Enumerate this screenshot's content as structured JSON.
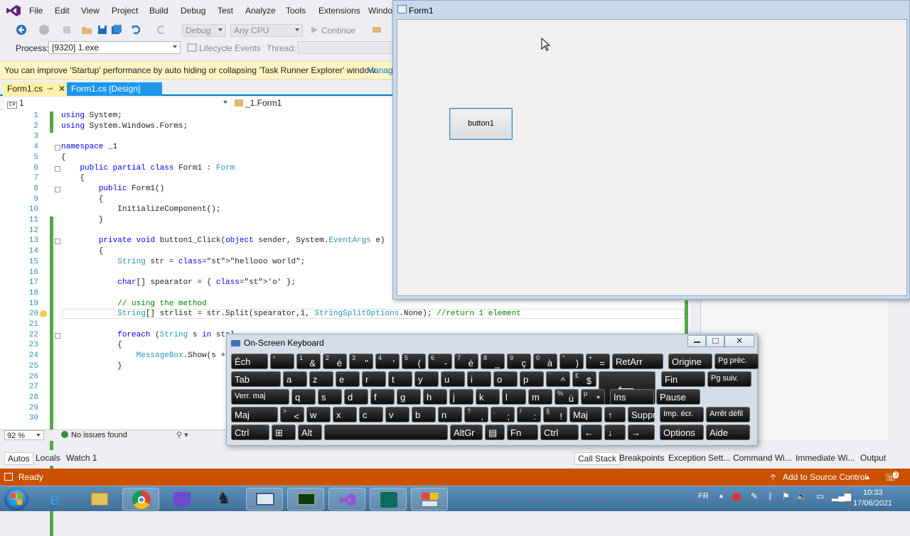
{
  "menu": [
    "File",
    "Edit",
    "View",
    "Project",
    "Build",
    "Debug",
    "Test",
    "Analyze",
    "Tools",
    "Extensions",
    "Windo"
  ],
  "toolbar": {
    "config": "Debug",
    "platform": "Any CPU",
    "continue": "Continue"
  },
  "toolbar2": {
    "process_label": "Process:",
    "process_value": "[9320] 1.exe",
    "lifecycle": "Lifecycle Events",
    "thread_label": "Thread:"
  },
  "infobar": {
    "message": "You can improve 'Startup' performance by auto hiding or collapsing 'Task Runner Explorer' window.",
    "link": "Manag"
  },
  "tabs": [
    {
      "label": "Form1.cs"
    },
    {
      "label": "Form1.cs [Design]"
    }
  ],
  "navbar": {
    "left": "1",
    "right": "_1.Form1"
  },
  "code": [
    {
      "n": "1",
      "t": "using System;"
    },
    {
      "n": "2",
      "t": "using System.Windows.Forms;"
    },
    {
      "n": "3",
      "t": ""
    },
    {
      "n": "4",
      "t": "namespace _1"
    },
    {
      "n": "5",
      "t": "{"
    },
    {
      "n": "6",
      "t": "    public partial class Form1 : Form"
    },
    {
      "n": "7",
      "t": "    {"
    },
    {
      "n": "8",
      "t": "        public Form1()"
    },
    {
      "n": "9",
      "t": "        {"
    },
    {
      "n": "10",
      "t": "            InitializeComponent();"
    },
    {
      "n": "11",
      "t": "        }"
    },
    {
      "n": "12",
      "t": ""
    },
    {
      "n": "13",
      "t": "        private void button1_Click(object sender, System.EventArgs e)"
    },
    {
      "n": "14",
      "t": "        {"
    },
    {
      "n": "15",
      "t": "            String str = \"hellooo world\";"
    },
    {
      "n": "16",
      "t": ""
    },
    {
      "n": "17",
      "t": "            char[] spearator = { 'o' };"
    },
    {
      "n": "18",
      "t": ""
    },
    {
      "n": "19",
      "t": "            // using the method"
    },
    {
      "n": "20",
      "t": "            String[] strlist = str.Split(spearator,1, StringSplitOptions.None); //return 1 element"
    },
    {
      "n": "21",
      "t": ""
    },
    {
      "n": "22",
      "t": "            foreach (String s in strl"
    },
    {
      "n": "23",
      "t": "            {"
    },
    {
      "n": "24",
      "t": "                MessageBox.Show(s + \""
    },
    {
      "n": "25",
      "t": "            }"
    },
    {
      "n": "26",
      "t": ""
    },
    {
      "n": "27",
      "t": ""
    },
    {
      "n": "28",
      "t": ""
    },
    {
      "n": "29",
      "t": ""
    },
    {
      "n": "30",
      "t": ""
    }
  ],
  "editor_status": {
    "zoom": "92 %",
    "issues": "No issues found"
  },
  "bottom_tabs_left": [
    "Autos",
    "Locals",
    "Watch 1"
  ],
  "bottom_tabs_right": [
    "Call Stack",
    "Breakpoints",
    "Exception Sett...",
    "Command Wi...",
    "Immediate Wi...",
    "Output"
  ],
  "status": {
    "ready": "Ready",
    "source_control": "Add to Source Control",
    "notif": "3"
  },
  "form1": {
    "title": "Form1",
    "button": "button1"
  },
  "osk": {
    "title": "On-Screen Keyboard",
    "rows": [
      [
        {
          "m": "Éch",
          "w": 52
        },
        {
          "s": "²",
          "w": 34
        },
        {
          "s": "1",
          "b": "&",
          "w": 34
        },
        {
          "s": "2",
          "b": "é",
          "w": 34
        },
        {
          "s": "3",
          "b": "\"",
          "w": 34
        },
        {
          "s": "4",
          "b": "'",
          "w": 34
        },
        {
          "s": "5",
          "b": "(",
          "w": 34
        },
        {
          "s": "6",
          "b": "-",
          "w": 34
        },
        {
          "s": "7",
          "b": "è",
          "w": 34
        },
        {
          "s": "8",
          "b": "_",
          "w": 34
        },
        {
          "s": "9",
          "b": "ç",
          "w": 34
        },
        {
          "s": "0",
          "b": "à",
          "w": 34
        },
        {
          "s": "°",
          "b": ")",
          "w": 34
        },
        {
          "s": "+",
          "b": "=",
          "w": 34
        },
        {
          "m": "RetArr",
          "w": 72
        },
        {
          "m": "Origine",
          "w": 62,
          "gap": 4
        },
        {
          "m": "Pg préc.",
          "w": 62
        }
      ],
      [
        {
          "m": "Tab",
          "w": 70
        },
        {
          "m": "a",
          "w": 34
        },
        {
          "m": "z",
          "w": 34
        },
        {
          "m": "e",
          "w": 34
        },
        {
          "m": "r",
          "w": 34
        },
        {
          "m": "t",
          "w": 34
        },
        {
          "m": "y",
          "w": 34
        },
        {
          "m": "u",
          "w": 34
        },
        {
          "m": "i",
          "w": 34
        },
        {
          "m": "o",
          "w": 34
        },
        {
          "m": "p",
          "w": 34
        },
        {
          "s": "¨",
          "b": "^",
          "w": 34
        },
        {
          "s": "£",
          "b": "$",
          "w": 34
        },
        {
          "m": "",
          "w": 0,
          "enter": true
        },
        {
          "m": "Fin",
          "w": 62,
          "gap": 4
        },
        {
          "m": "Pg suiv.",
          "w": 62
        }
      ],
      [
        {
          "m": "Verr. maj",
          "w": 82
        },
        {
          "m": "q",
          "w": 34
        },
        {
          "m": "s",
          "w": 34
        },
        {
          "m": "d",
          "w": 34
        },
        {
          "m": "f",
          "w": 34
        },
        {
          "m": "g",
          "w": 34
        },
        {
          "m": "h",
          "w": 34
        },
        {
          "m": "j",
          "w": 34
        },
        {
          "m": "k",
          "w": 34
        },
        {
          "m": "l",
          "w": 34
        },
        {
          "m": "m",
          "w": 34
        },
        {
          "s": "%",
          "b": "ù",
          "w": 34
        },
        {
          "s": "µ",
          "b": "*",
          "w": 34
        },
        {
          "m": "Ins",
          "w": 62,
          "gap": 4
        },
        {
          "m": "Pause",
          "w": 62
        }
      ],
      [
        {
          "m": "Maj",
          "w": 66
        },
        {
          "s": ">",
          "b": "<",
          "w": 34
        },
        {
          "m": "w",
          "w": 34
        },
        {
          "m": "x",
          "w": 34
        },
        {
          "m": "c",
          "w": 34
        },
        {
          "m": "v",
          "w": 34
        },
        {
          "m": "b",
          "w": 34
        },
        {
          "m": "n",
          "w": 34
        },
        {
          "s": "?",
          "b": ",",
          "w": 34
        },
        {
          "s": ".",
          "b": ";",
          "w": 34
        },
        {
          "s": "/",
          "b": ":",
          "w": 34
        },
        {
          "s": "§",
          "b": "!",
          "w": 34
        },
        {
          "m": "Maj",
          "w": 46
        },
        {
          "m": "↑",
          "w": 30
        },
        {
          "m": "Suppr",
          "w": 38
        },
        {
          "m": "Imp. écr.",
          "w": 62,
          "gap": 4
        },
        {
          "m": "Arrêt défil",
          "w": 62
        }
      ],
      [
        {
          "m": "Ctrl",
          "w": 54
        },
        {
          "m": "⊞",
          "w": 34
        },
        {
          "m": "Alt",
          "w": 34
        },
        {
          "m": "",
          "w": 174
        },
        {
          "m": "AltGr",
          "w": 46
        },
        {
          "m": "▤",
          "w": 28
        },
        {
          "m": "Fn",
          "w": 44
        },
        {
          "m": "Ctrl",
          "w": 54
        },
        {
          "m": "←",
          "w": 30
        },
        {
          "m": "↓",
          "w": 30
        },
        {
          "m": "→",
          "w": 38
        },
        {
          "m": "Options",
          "w": 62,
          "gap": 4
        },
        {
          "m": "Aide",
          "w": 62
        }
      ]
    ]
  },
  "taskbar": {
    "lang": "FR",
    "time": "10:33",
    "date": "17/06/2021"
  },
  "colors": {
    "accent": "#007acc",
    "status_bar": "#ca5100",
    "infobar": "#fdf5c4"
  }
}
